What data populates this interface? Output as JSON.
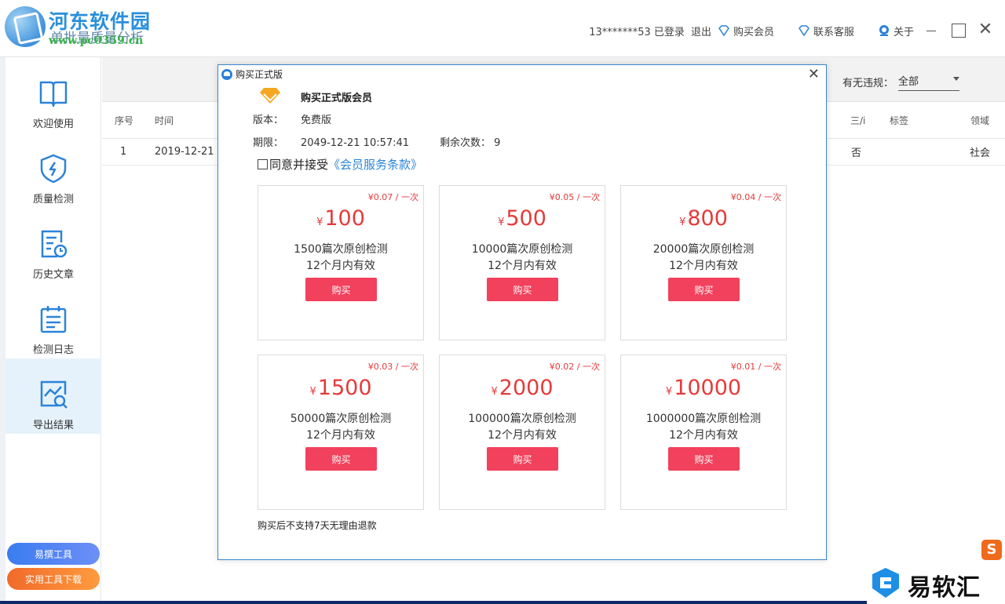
{
  "watermark": {
    "site_name": "河东软件园",
    "site_url": "www.pc0359.cn"
  },
  "app": {
    "title": "单批量质量分析"
  },
  "header": {
    "user": "13*******53 已登录",
    "logout": "退出",
    "buy_member": "购买会员",
    "contact": "联系客服",
    "about": "关于",
    "close_glyph": "✕"
  },
  "sidebar": {
    "items": [
      {
        "label": "欢迎使用",
        "icon": "book-icon"
      },
      {
        "label": "质量检测",
        "icon": "shield-icon"
      },
      {
        "label": "历史文章",
        "icon": "history-doc-icon"
      },
      {
        "label": "检测日志",
        "icon": "calendar-icon"
      },
      {
        "label": "导出结果",
        "icon": "chart-search-icon"
      }
    ],
    "active_index": 4,
    "btn_tool": "易撰工具",
    "btn_download": "实用工具下载"
  },
  "toolbar": {
    "filter_label": "有无违规：",
    "filter_value": "全部"
  },
  "table": {
    "headers": {
      "index": "序号",
      "time": "时间",
      "col_three": "三/i",
      "tags": "标签",
      "domain": "领域"
    },
    "row": {
      "index": "1",
      "time": "2019-12-21",
      "col_three": "否",
      "domain": "社会"
    }
  },
  "dialog": {
    "title": "购买正式版",
    "close": "✕",
    "heading": "购买正式版会员",
    "version_label": "版本：",
    "version_value": "免费版",
    "expiry_label": "期限：",
    "expiry_value": "2049-12-21 10:57:41",
    "remain_label": "剩余次数：",
    "remain_value": "9",
    "agree_text": "同意并接受",
    "agree_link": "《会员服务条款》",
    "currency": "¥",
    "plans": [
      {
        "unit": "¥0.07 / 一次",
        "price": "100",
        "count": "1500篇次原创检测",
        "valid": "12个月内有效",
        "buy": "购买"
      },
      {
        "unit": "¥0.05 / 一次",
        "price": "500",
        "count": "10000篇次原创检测",
        "valid": "12个月内有效",
        "buy": "购买"
      },
      {
        "unit": "¥0.04 / 一次",
        "price": "800",
        "count": "20000篇次原创检测",
        "valid": "12个月内有效",
        "buy": "购买"
      },
      {
        "unit": "¥0.03 / 一次",
        "price": "1500",
        "count": "50000篇次原创检测",
        "valid": "12个月内有效",
        "buy": "购买"
      },
      {
        "unit": "¥0.02 / 一次",
        "price": "2000",
        "count": "100000篇次原创检测",
        "valid": "12个月内有效",
        "buy": "购买"
      },
      {
        "unit": "¥0.01 / 一次",
        "price": "10000",
        "count": "1000000篇次原创检测",
        "valid": "12个月内有效",
        "buy": "购买"
      }
    ],
    "note": "购买后不支持7天无理由退款"
  },
  "brand": {
    "badge": "S",
    "text": "易软汇"
  },
  "colors": {
    "accent": "#2b83d8",
    "buy": "#f2415c",
    "price": "#e63a3a",
    "active_nav": "#e6f2fb"
  }
}
